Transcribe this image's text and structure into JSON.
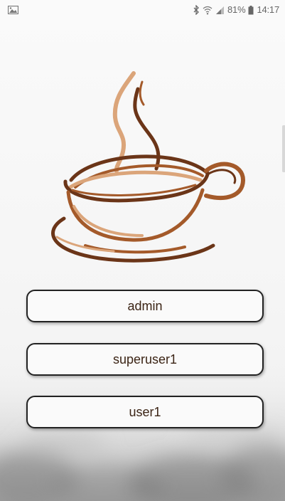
{
  "status_bar": {
    "left_icon": "image-icon",
    "bluetooth_icon": "bluetooth-icon",
    "wifi_icon": "wifi-icon",
    "signal_icon": "signal-icon",
    "battery_percent": "81%",
    "battery_icon": "battery-icon",
    "time": "14:17"
  },
  "logo": {
    "icon": "coffee-cup-icon",
    "colors": {
      "dark": "#6b3518",
      "medium": "#a45a2a",
      "light": "#dba57a"
    }
  },
  "users": [
    {
      "label": "admin"
    },
    {
      "label": "superuser1"
    },
    {
      "label": "user1"
    }
  ]
}
